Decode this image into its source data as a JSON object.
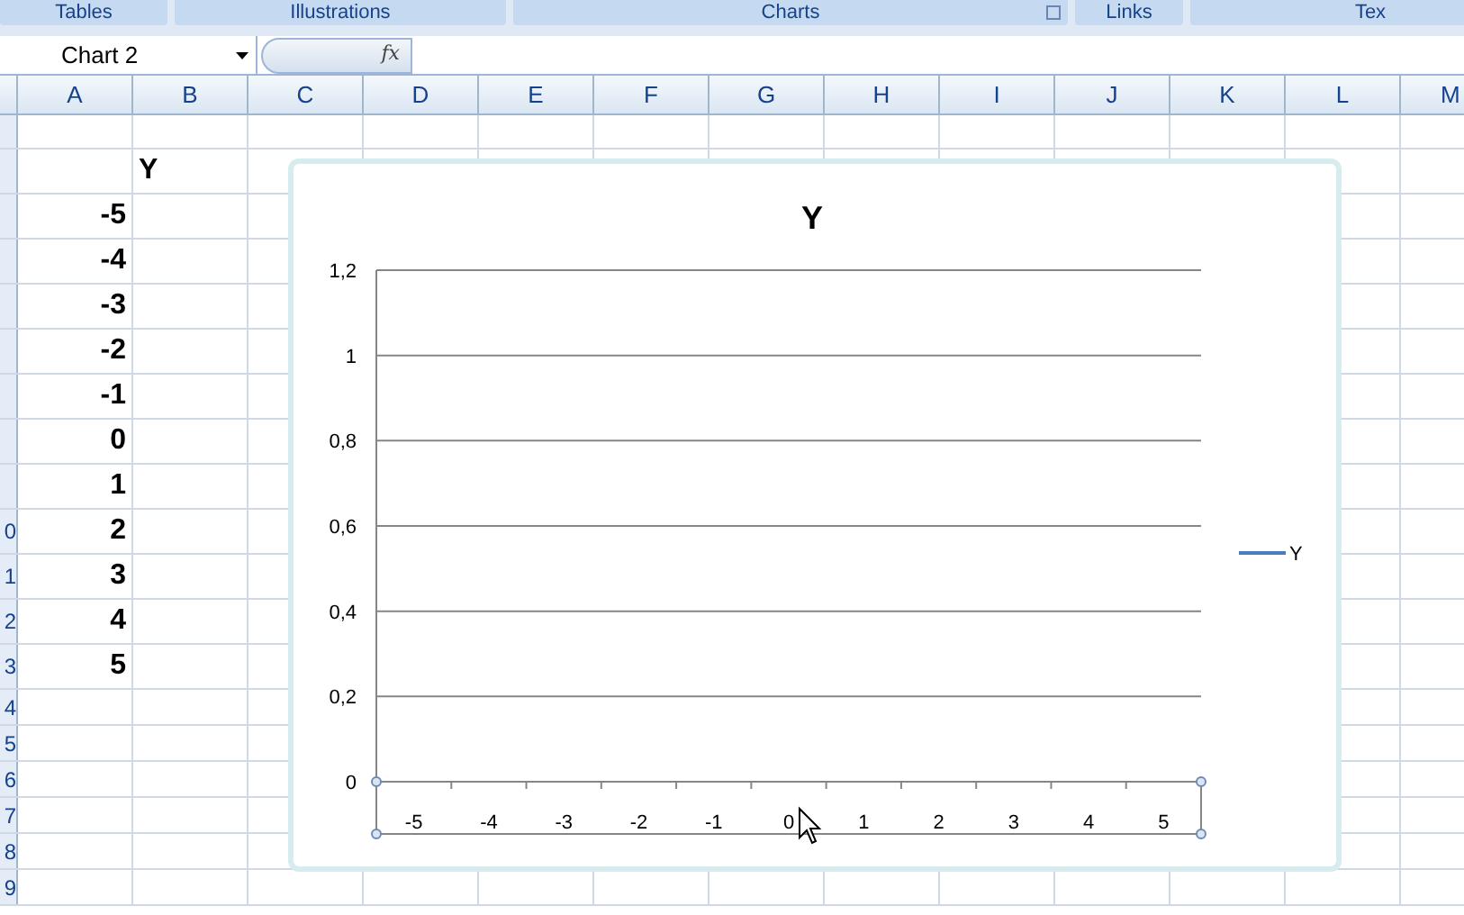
{
  "ribbon_groups": [
    {
      "label": "Tables"
    },
    {
      "label": "Illustrations"
    },
    {
      "label": "Charts",
      "launcher": true
    },
    {
      "label": "Links"
    },
    {
      "label": "Tex"
    }
  ],
  "name_box": {
    "value": "Chart 2"
  },
  "formula_bar": {
    "fx": "fx"
  },
  "columns": [
    "A",
    "B",
    "C",
    "D",
    "E",
    "F",
    "G",
    "H",
    "I",
    "J",
    "K",
    "L",
    "M"
  ],
  "rows": [
    {
      "header": "",
      "a": "",
      "b": ""
    },
    {
      "header": "",
      "a": "",
      "b": "Y"
    },
    {
      "header": "",
      "a": "-5",
      "b": ""
    },
    {
      "header": "",
      "a": "-4",
      "b": ""
    },
    {
      "header": "",
      "a": "-3",
      "b": ""
    },
    {
      "header": "",
      "a": "-2",
      "b": ""
    },
    {
      "header": "",
      "a": "-1",
      "b": ""
    },
    {
      "header": "",
      "a": "0",
      "b": ""
    },
    {
      "header": "",
      "a": "1",
      "b": ""
    },
    {
      "header": "0",
      "a": "2",
      "b": ""
    },
    {
      "header": "1",
      "a": "3",
      "b": ""
    },
    {
      "header": "2",
      "a": "4",
      "b": ""
    },
    {
      "header": "3",
      "a": "5",
      "b": ""
    },
    {
      "header": "4",
      "a": "",
      "b": ""
    },
    {
      "header": "5",
      "a": "",
      "b": ""
    },
    {
      "header": "6",
      "a": "",
      "b": ""
    },
    {
      "header": "7",
      "a": "",
      "b": ""
    },
    {
      "header": "8",
      "a": "",
      "b": ""
    },
    {
      "header": "9",
      "a": "",
      "b": ""
    }
  ],
  "chart": {
    "chart_data": {
      "type": "line",
      "title": "Y",
      "categories": [
        "-5",
        "-4",
        "-3",
        "-2",
        "-1",
        "0",
        "1",
        "2",
        "3",
        "4",
        "5"
      ],
      "series": [
        {
          "name": "Y",
          "color": "#4a7ebb",
          "values": [
            null,
            null,
            null,
            null,
            null,
            null,
            null,
            null,
            null,
            null,
            null
          ]
        }
      ],
      "ylim": [
        0,
        1.2
      ],
      "grid": true,
      "yticks": [
        {
          "value": 0,
          "label": "0"
        },
        {
          "value": 0.2,
          "label": "0,2"
        },
        {
          "value": 0.4,
          "label": "0,4"
        },
        {
          "value": 0.6,
          "label": "0,6"
        },
        {
          "value": 0.8,
          "label": "0,8"
        },
        {
          "value": 1,
          "label": "1"
        },
        {
          "value": 1.2,
          "label": "1,2"
        }
      ]
    }
  }
}
